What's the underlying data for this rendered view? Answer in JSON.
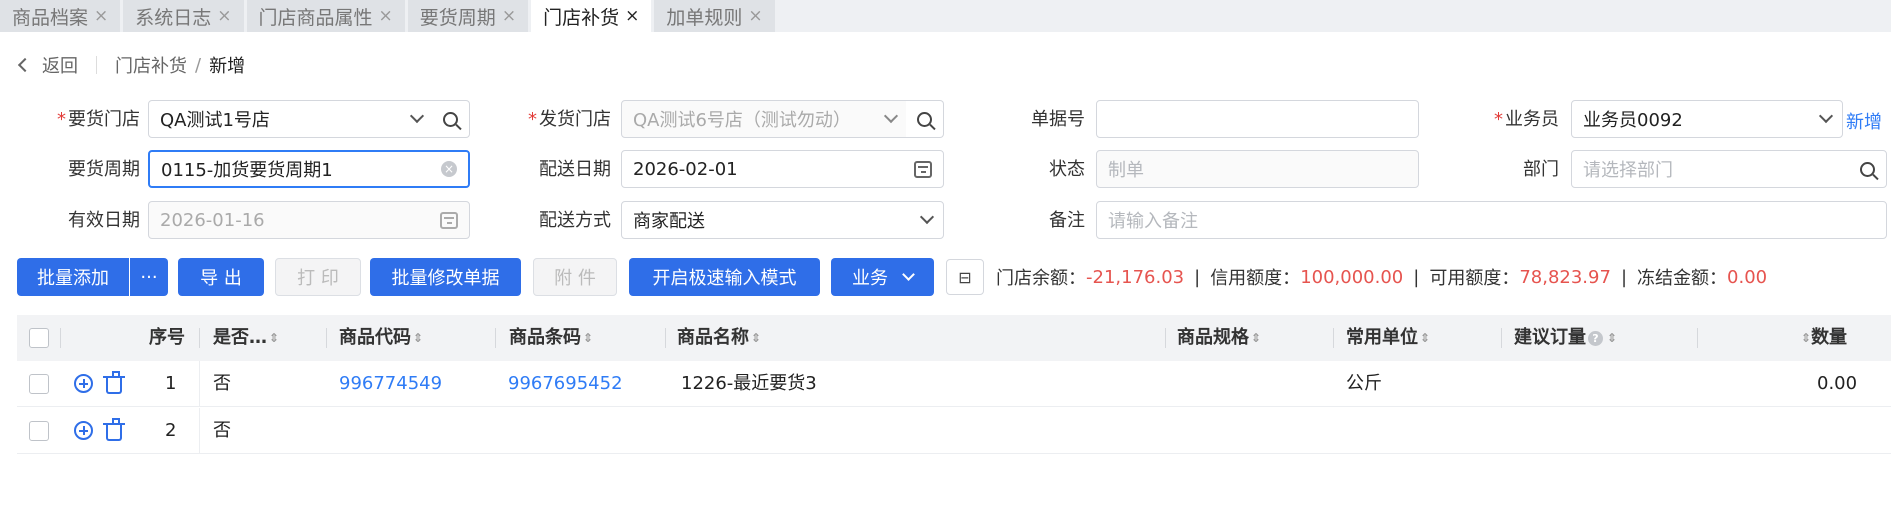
{
  "tabs": [
    {
      "label": "商品档案",
      "active": false
    },
    {
      "label": "系统日志",
      "active": false
    },
    {
      "label": "门店商品属性",
      "active": false
    },
    {
      "label": "要货周期",
      "active": false
    },
    {
      "label": "门店补货",
      "active": true
    },
    {
      "label": "加单规则",
      "active": false
    }
  ],
  "tab_close": "×",
  "breadcrumb": {
    "back": "返回",
    "parent": "门店补货",
    "separator": "/",
    "current": "新增"
  },
  "form": {
    "required_mark": "*",
    "req_store": {
      "label": "要货门店",
      "value": "QA测试1号店"
    },
    "ship_store": {
      "label": "发货门店",
      "value": "QA测试6号店（测试勿动）"
    },
    "doc_no": {
      "label": "单据号",
      "value": ""
    },
    "salesman": {
      "label": "业务员",
      "value": "业务员0092",
      "new_link": "新增"
    },
    "req_cycle": {
      "label": "要货周期",
      "value": "0115-加货要货周期1"
    },
    "delivery_date": {
      "label": "配送日期",
      "value": "2026-02-01"
    },
    "status": {
      "label": "状态",
      "placeholder": "制单"
    },
    "department": {
      "label": "部门",
      "placeholder": "请选择部门"
    },
    "valid_date": {
      "label": "有效日期",
      "value": "2026-01-16"
    },
    "delivery_method": {
      "label": "配送方式",
      "value": "商家配送"
    },
    "remark": {
      "label": "备注",
      "placeholder": "请输入备注"
    }
  },
  "toolbar": {
    "batch_add": "批量添加",
    "more": "···",
    "export": "导 出",
    "print": "打 印",
    "batch_edit": "批量修改单据",
    "attachment": "附 件",
    "fast_input": "开启极速输入模式",
    "business": "业务",
    "column_icon": "⊟"
  },
  "stats": {
    "store_balance_label": "门店余额：",
    "store_balance": "-21,176.03",
    "credit_label": "信用额度：",
    "credit": "100,000.00",
    "available_label": "可用额度：",
    "available": "78,823.97",
    "frozen_label": "冻结金额：",
    "frozen": "0.00",
    "divider": "|"
  },
  "table": {
    "sort_glyph": "⇕",
    "help_glyph": "?",
    "columns": [
      "序号",
      "是否…",
      "商品代码",
      "商品条码",
      "商品名称",
      "商品规格",
      "常用单位",
      "建议订量",
      "数量"
    ],
    "rows": [
      {
        "index": "1",
        "flag": "否",
        "code": "996774549",
        "barcode": "9967695452",
        "name": "1226-最近要货3",
        "spec": "",
        "unit": "公斤",
        "suggest": "",
        "qty": "0.00"
      },
      {
        "index": "2",
        "flag": "否",
        "code": "",
        "barcode": "",
        "name": "",
        "spec": "",
        "unit": "",
        "suggest": "",
        "qty": ""
      }
    ]
  },
  "colors": {
    "primary": "#2f6ee8",
    "link": "#2f7cf6",
    "negative": "#e6544f",
    "required": "#e23c39"
  }
}
